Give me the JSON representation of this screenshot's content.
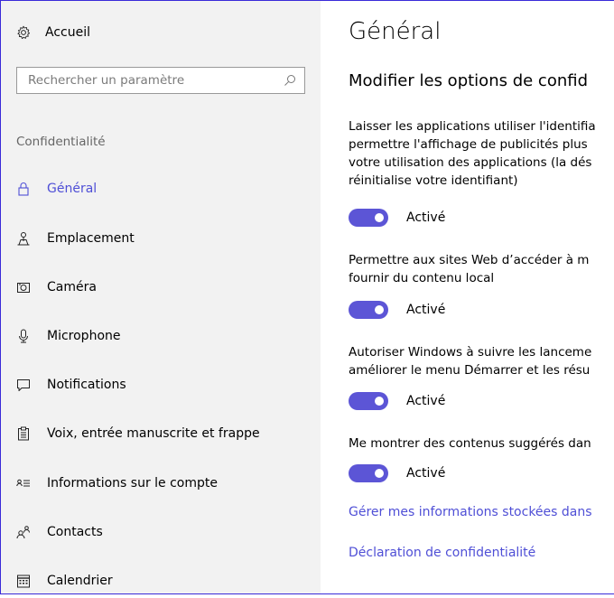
{
  "sidebar": {
    "home_label": "Accueil",
    "search_placeholder": "Rechercher un paramètre",
    "section_title": "Confidentialité",
    "items": [
      {
        "label": "Général",
        "icon": "lock-icon",
        "active": true
      },
      {
        "label": "Emplacement",
        "icon": "location-icon"
      },
      {
        "label": "Caméra",
        "icon": "camera-icon"
      },
      {
        "label": "Microphone",
        "icon": "microphone-icon"
      },
      {
        "label": "Notifications",
        "icon": "notification-icon"
      },
      {
        "label": "Voix, entrée manuscrite et frappe",
        "icon": "clipboard-icon"
      },
      {
        "label": "Informations sur le compte",
        "icon": "account-info-icon"
      },
      {
        "label": "Contacts",
        "icon": "contacts-icon"
      },
      {
        "label": "Calendrier",
        "icon": "calendar-icon"
      }
    ]
  },
  "main": {
    "title": "Général",
    "subtitle": "Modifier les options de confid",
    "settings": [
      {
        "description": [
          "Laisser les applications utiliser l'identifia",
          "permettre l'affichage de publicités plus",
          "votre utilisation des applications (la dés",
          "réinitialise votre identifiant)"
        ],
        "state": "Activé"
      },
      {
        "description": [
          "Permettre aux sites Web d’accéder à m",
          "fournir du contenu local"
        ],
        "state": "Activé"
      },
      {
        "description": [
          "Autoriser Windows à suivre les lanceme",
          "améliorer le menu Démarrer et les résu"
        ],
        "state": "Activé"
      },
      {
        "description": [
          "Me montrer des contenus suggérés dan"
        ],
        "state": "Activé"
      }
    ],
    "links": [
      "Gérer mes informations stockées dans",
      "Déclaration de confidentialité"
    ]
  },
  "colors": {
    "accent": "#4f4fd6",
    "toggle_on": "#5c55d6",
    "sidebar_bg": "#f2f2f2"
  }
}
